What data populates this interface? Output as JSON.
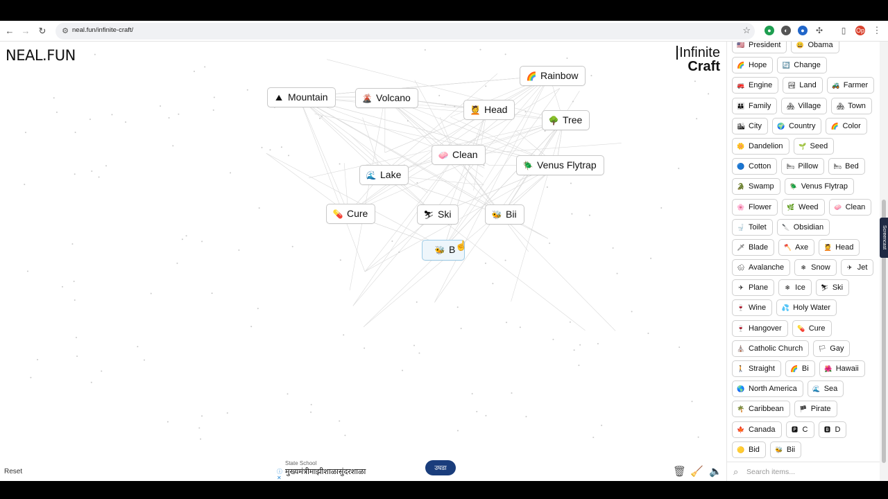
{
  "browser": {
    "url": "neal.fun/infinite-craft/",
    "back_icon": "arrow-left-icon",
    "forward_icon": "arrow-right-icon",
    "reload_icon": "reload-icon",
    "star_icon": "star-icon",
    "profile_initials": "Op"
  },
  "header": {
    "site_logo": "NEAL.FUN",
    "game_logo_line1": "Infinite",
    "game_logo_line2": "Craft"
  },
  "canvas_chips": [
    {
      "emoji": "⛰",
      "label": "Mountain"
    },
    {
      "emoji": "🌋",
      "label": "Volcano"
    },
    {
      "emoji": "🌈",
      "label": "Rainbow"
    },
    {
      "emoji": "💆",
      "label": "Head"
    },
    {
      "emoji": "🌳",
      "label": "Tree"
    },
    {
      "emoji": "🧼",
      "label": "Clean"
    },
    {
      "emoji": "🪲",
      "label": "Venus Flytrap"
    },
    {
      "emoji": "🌊",
      "label": "Lake"
    },
    {
      "emoji": "💊",
      "label": "Cure"
    },
    {
      "emoji": "⛷",
      "label": "Ski"
    },
    {
      "emoji": "🐝",
      "label": "Bii"
    },
    {
      "emoji": "🐝",
      "label": "B"
    }
  ],
  "sidebar_items": [
    {
      "emoji": "🇺🇸",
      "label": "President"
    },
    {
      "emoji": "😀",
      "label": "Obama"
    },
    {
      "emoji": "🌈",
      "label": "Hope"
    },
    {
      "emoji": "🔄",
      "label": "Change"
    },
    {
      "emoji": "🚒",
      "label": "Engine"
    },
    {
      "emoji": "🏞",
      "label": "Land"
    },
    {
      "emoji": "🚜",
      "label": "Farmer"
    },
    {
      "emoji": "👪",
      "label": "Family"
    },
    {
      "emoji": "🏘",
      "label": "Village"
    },
    {
      "emoji": "🏘",
      "label": "Town"
    },
    {
      "emoji": "🏙",
      "label": "City"
    },
    {
      "emoji": "🌍",
      "label": "Country"
    },
    {
      "emoji": "🌈",
      "label": "Color"
    },
    {
      "emoji": "🌼",
      "label": "Dandelion"
    },
    {
      "emoji": "🌱",
      "label": "Seed"
    },
    {
      "emoji": "🔵",
      "label": "Cotton"
    },
    {
      "emoji": "🛏",
      "label": "Pillow"
    },
    {
      "emoji": "🛏",
      "label": "Bed"
    },
    {
      "emoji": "🐊",
      "label": "Swamp"
    },
    {
      "emoji": "🪲",
      "label": "Venus Flytrap"
    },
    {
      "emoji": "🌸",
      "label": "Flower"
    },
    {
      "emoji": "🌿",
      "label": "Weed"
    },
    {
      "emoji": "🧼",
      "label": "Clean"
    },
    {
      "emoji": "🚽",
      "label": "Toilet"
    },
    {
      "emoji": "🔪",
      "label": "Obsidian"
    },
    {
      "emoji": "🗡",
      "label": "Blade"
    },
    {
      "emoji": "🪓",
      "label": "Axe"
    },
    {
      "emoji": "💆",
      "label": "Head"
    },
    {
      "emoji": "🌨",
      "label": "Avalanche"
    },
    {
      "emoji": "❄",
      "label": "Snow"
    },
    {
      "emoji": "✈",
      "label": "Jet"
    },
    {
      "emoji": "✈",
      "label": "Plane"
    },
    {
      "emoji": "❄",
      "label": "Ice"
    },
    {
      "emoji": "⛷",
      "label": "Ski"
    },
    {
      "emoji": "🍷",
      "label": "Wine"
    },
    {
      "emoji": "💦",
      "label": "Holy Water"
    },
    {
      "emoji": "🍷",
      "label": "Hangover"
    },
    {
      "emoji": "💊",
      "label": "Cure"
    },
    {
      "emoji": "⛪",
      "label": "Catholic Church"
    },
    {
      "emoji": "🏳",
      "label": "Gay"
    },
    {
      "emoji": "🚶",
      "label": "Straight"
    },
    {
      "emoji": "🌈",
      "label": "Bi"
    },
    {
      "emoji": "🌺",
      "label": "Hawaii"
    },
    {
      "emoji": "🌎",
      "label": "North America"
    },
    {
      "emoji": "🌊",
      "label": "Sea"
    },
    {
      "emoji": "🌴",
      "label": "Caribbean"
    },
    {
      "emoji": "🏴",
      "label": "Pirate"
    },
    {
      "emoji": "🍁",
      "label": "Canada"
    },
    {
      "emoji": "🅿",
      "label": "C"
    },
    {
      "emoji": "🅱",
      "label": "D"
    },
    {
      "emoji": "🟡",
      "label": "Bid"
    },
    {
      "emoji": "🐝",
      "label": "Bii"
    }
  ],
  "search": {
    "placeholder": "Search items..."
  },
  "footer": {
    "reset_label": "Reset"
  },
  "ad": {
    "small_text": "State School",
    "main_text": "मुख्यमंत्रीमाझीशाळासुंदरशाळा",
    "button_label": "उघडा"
  },
  "screencast_tab_label": "Screencast",
  "colors": {
    "chip_border": "#c8c8c8",
    "selected_chip_bg": "#eef6fb",
    "ad_button": "#1a3d7c"
  }
}
